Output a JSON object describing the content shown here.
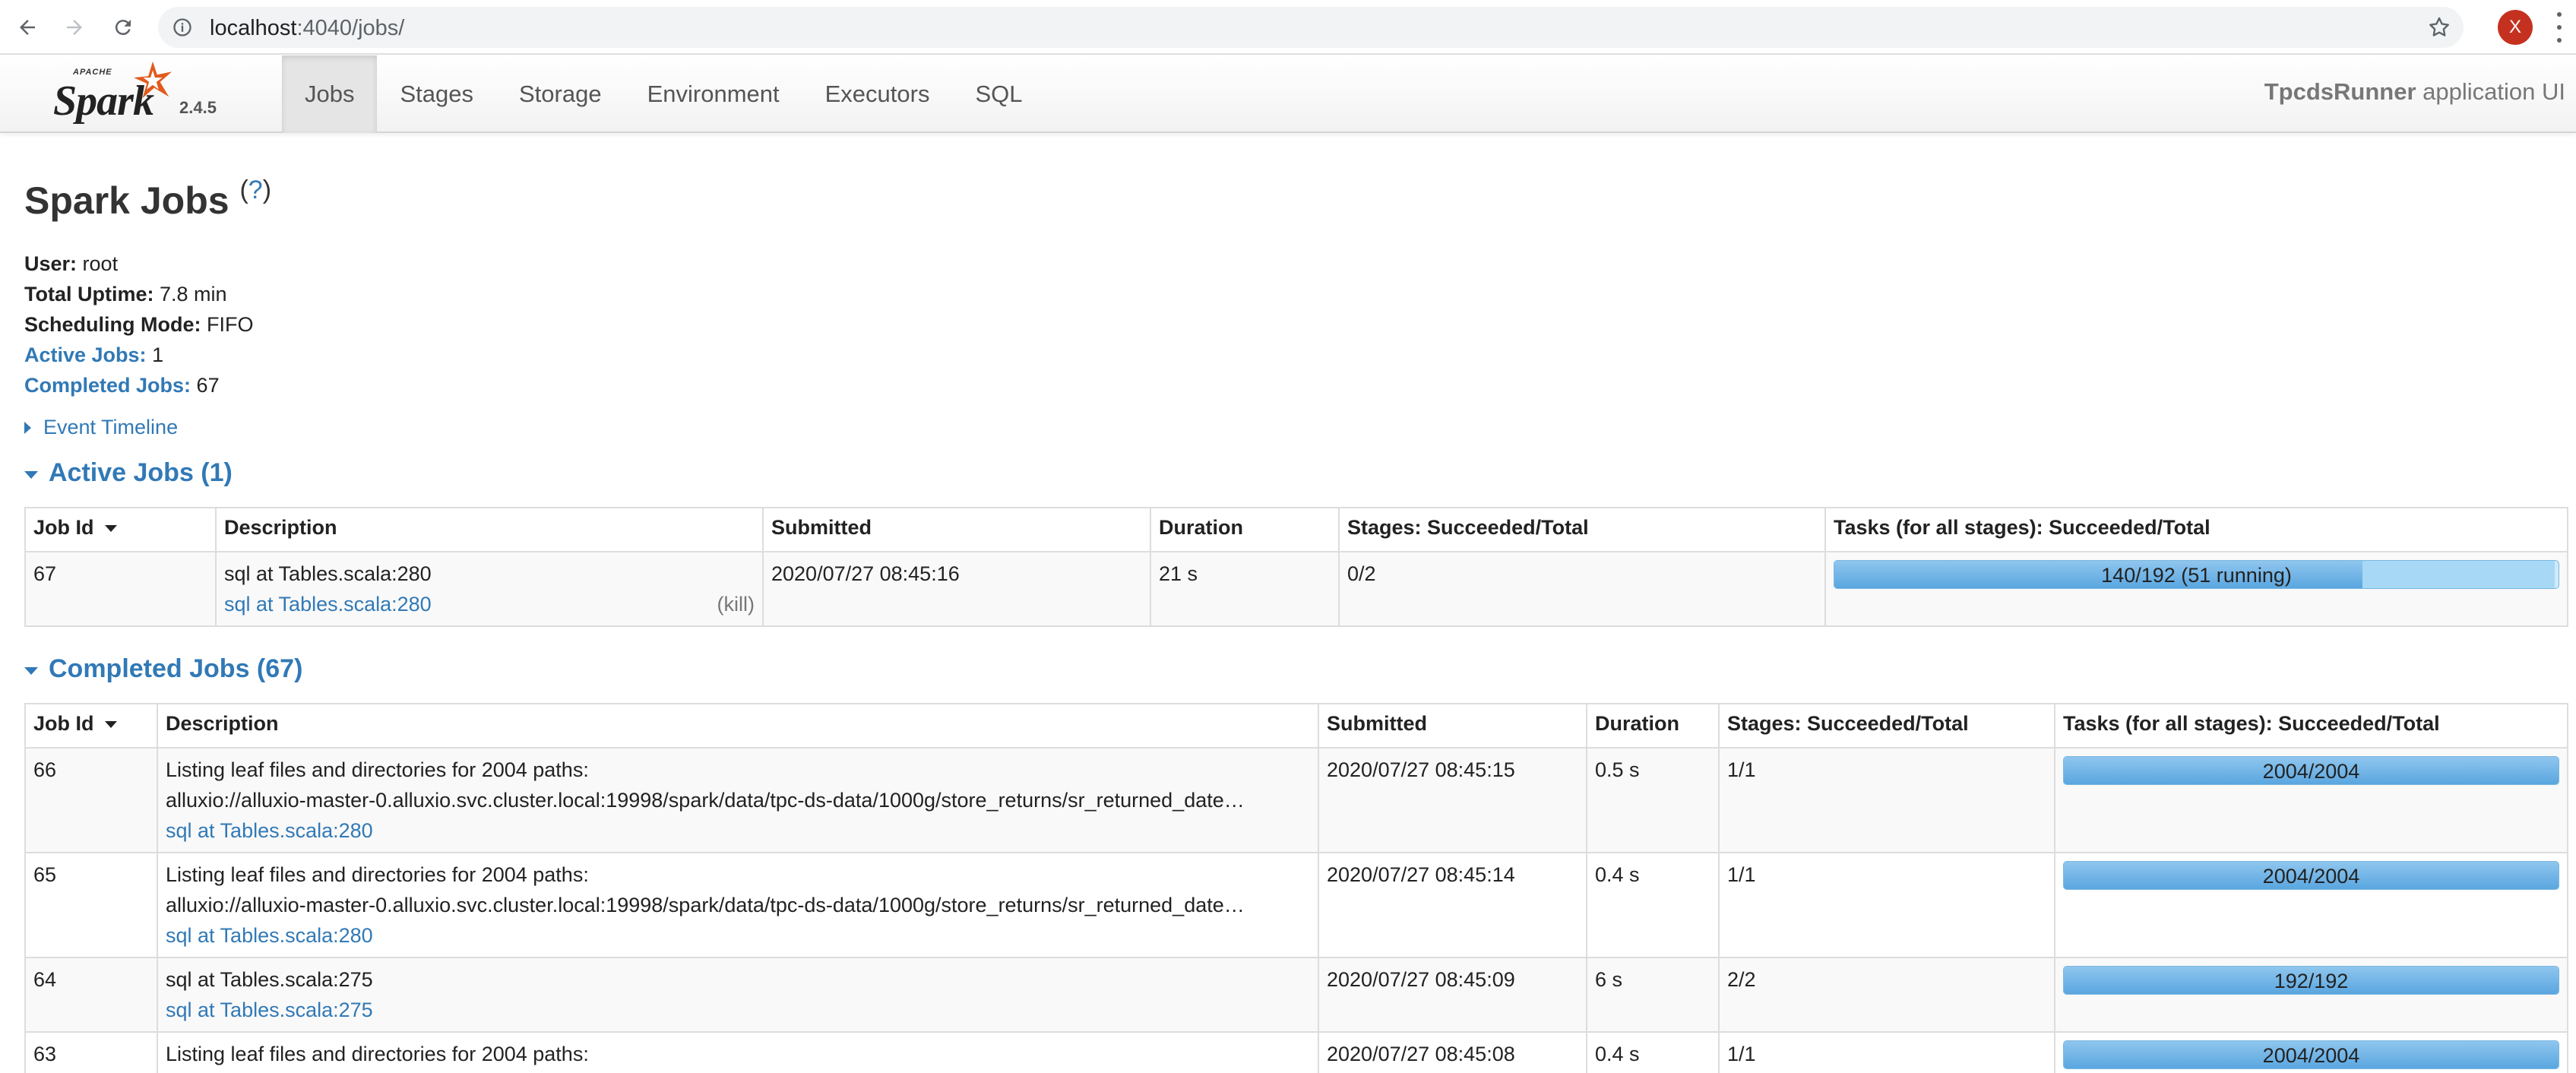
{
  "browser": {
    "url_host": "localhost",
    "url_port_path": ":4040/jobs/",
    "profile_initial": "X"
  },
  "navbar": {
    "logo_apache": "APACHE",
    "logo_spark": "Spark",
    "version": "2.4.5",
    "tabs": [
      {
        "label": "Jobs",
        "active": true
      },
      {
        "label": "Stages",
        "active": false
      },
      {
        "label": "Storage",
        "active": false
      },
      {
        "label": "Environment",
        "active": false
      },
      {
        "label": "Executors",
        "active": false
      },
      {
        "label": "SQL",
        "active": false
      }
    ],
    "app_name": "TpcdsRunner",
    "app_suffix": " application UI"
  },
  "page": {
    "title": "Spark Jobs",
    "help": "(?)",
    "help_q": "?",
    "summary": {
      "user_label": "User:",
      "user": "root",
      "uptime_label": "Total Uptime:",
      "uptime": "7.8 min",
      "mode_label": "Scheduling Mode:",
      "mode": "FIFO",
      "active_label": "Active Jobs:",
      "active": "1",
      "completed_label": "Completed Jobs:",
      "completed": "67"
    },
    "event_timeline": "Event Timeline"
  },
  "active_jobs": {
    "heading": "Active Jobs (1)",
    "columns": [
      "Job Id",
      "Description",
      "Submitted",
      "Duration",
      "Stages: Succeeded/Total",
      "Tasks (for all stages): Succeeded/Total"
    ],
    "rows": [
      {
        "job_id": "67",
        "desc_line1": "sql at Tables.scala:280",
        "desc_link": "sql at Tables.scala:280",
        "kill": "(kill)",
        "submitted": "2020/07/27 08:45:16",
        "duration": "21 s",
        "stages": "0/2",
        "tasks_label": "140/192 (51 running)",
        "tasks_succeeded": 140,
        "tasks_running": 51,
        "tasks_total": 192
      }
    ]
  },
  "completed_jobs": {
    "heading": "Completed Jobs (67)",
    "columns": [
      "Job Id",
      "Description",
      "Submitted",
      "Duration",
      "Stages: Succeeded/Total",
      "Tasks (for all stages): Succeeded/Total"
    ],
    "rows": [
      {
        "job_id": "66",
        "desc_line1": "Listing leaf files and directories for 2004 paths:",
        "desc_line2": "alluxio://alluxio-master-0.alluxio.svc.cluster.local:19998/spark/data/tpc-ds-data/1000g/store_returns/sr_returned_date…",
        "desc_link": "sql at Tables.scala:280",
        "submitted": "2020/07/27 08:45:15",
        "duration": "0.5 s",
        "stages": "1/1",
        "tasks_label": "2004/2004",
        "tasks_succeeded": 2004,
        "tasks_total": 2004
      },
      {
        "job_id": "65",
        "desc_line1": "Listing leaf files and directories for 2004 paths:",
        "desc_line2": "alluxio://alluxio-master-0.alluxio.svc.cluster.local:19998/spark/data/tpc-ds-data/1000g/store_returns/sr_returned_date…",
        "desc_link": "sql at Tables.scala:280",
        "submitted": "2020/07/27 08:45:14",
        "duration": "0.4 s",
        "stages": "1/1",
        "tasks_label": "2004/2004",
        "tasks_succeeded": 2004,
        "tasks_total": 2004
      },
      {
        "job_id": "64",
        "desc_line1": "sql at Tables.scala:275",
        "desc_link": "sql at Tables.scala:275",
        "submitted": "2020/07/27 08:45:09",
        "duration": "6 s",
        "stages": "2/2",
        "tasks_label": "192/192",
        "tasks_succeeded": 192,
        "tasks_total": 192
      },
      {
        "job_id": "63",
        "desc_line1": "Listing leaf files and directories for 2004 paths:",
        "submitted": "2020/07/27 08:45:08",
        "duration": "0.4 s",
        "stages": "1/1",
        "tasks_label": "2004/2004",
        "tasks_succeeded": 2004,
        "tasks_total": 2004
      }
    ]
  }
}
